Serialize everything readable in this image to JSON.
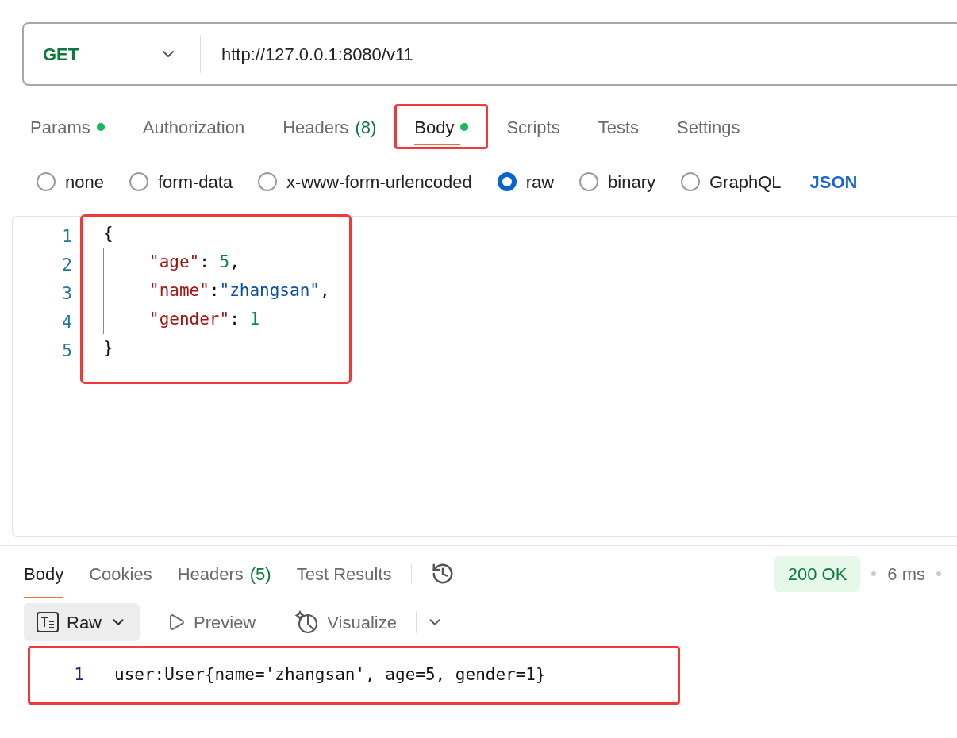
{
  "request": {
    "method": "GET",
    "url": "http://127.0.0.1:8080/v11"
  },
  "request_tabs": [
    {
      "label": "Params",
      "dot": true,
      "selected": false,
      "highlighted": false
    },
    {
      "label": "Authorization",
      "dot": false,
      "selected": false,
      "highlighted": false
    },
    {
      "label": "Headers",
      "count": "(8)",
      "dot": false,
      "selected": false,
      "highlighted": false
    },
    {
      "label": "Body",
      "dot": true,
      "selected": true,
      "highlighted": true
    },
    {
      "label": "Scripts",
      "dot": false,
      "selected": false,
      "highlighted": false
    },
    {
      "label": "Tests",
      "dot": false,
      "selected": false,
      "highlighted": false
    },
    {
      "label": "Settings",
      "dot": false,
      "selected": false,
      "highlighted": false
    }
  ],
  "body_types": [
    {
      "label": "none",
      "selected": false
    },
    {
      "label": "form-data",
      "selected": false
    },
    {
      "label": "x-www-form-urlencoded",
      "selected": false
    },
    {
      "label": "raw",
      "selected": true
    },
    {
      "label": "binary",
      "selected": false
    },
    {
      "label": "GraphQL",
      "selected": false
    }
  ],
  "body_format": "JSON",
  "editor": {
    "highlighted": true,
    "lines": [
      {
        "number": "1",
        "indent": false,
        "tokens": [
          {
            "text": "{",
            "kind": "punct"
          }
        ]
      },
      {
        "number": "2",
        "indent": true,
        "tokens": [
          {
            "text": "\"age\"",
            "kind": "key"
          },
          {
            "text": ": ",
            "kind": "punct"
          },
          {
            "text": "5",
            "kind": "number"
          },
          {
            "text": ",",
            "kind": "punct"
          }
        ]
      },
      {
        "number": "3",
        "indent": true,
        "tokens": [
          {
            "text": "\"name\"",
            "kind": "key"
          },
          {
            "text": ":",
            "kind": "punct"
          },
          {
            "text": "\"zhangsan\"",
            "kind": "string"
          },
          {
            "text": ",",
            "kind": "punct"
          }
        ]
      },
      {
        "number": "4",
        "indent": true,
        "tokens": [
          {
            "text": "\"gender\"",
            "kind": "key"
          },
          {
            "text": ": ",
            "kind": "punct"
          },
          {
            "text": "1",
            "kind": "number"
          }
        ]
      },
      {
        "number": "5",
        "indent": false,
        "tokens": [
          {
            "text": "}",
            "kind": "punct"
          }
        ]
      }
    ]
  },
  "response_tabs": [
    {
      "label": "Body",
      "selected": true
    },
    {
      "label": "Cookies",
      "selected": false
    },
    {
      "label": "Headers",
      "count": "(5)",
      "selected": false
    },
    {
      "label": "Test Results",
      "selected": false
    }
  ],
  "status": {
    "code": "200 OK",
    "time": "6 ms"
  },
  "view_modes": [
    {
      "label": "Raw",
      "selected": true
    },
    {
      "label": "Preview",
      "selected": false
    },
    {
      "label": "Visualize",
      "selected": false
    }
  ],
  "response": {
    "highlighted": true,
    "lines": [
      {
        "number": "1",
        "text": "user:User{name='zhangsan', age=5, gender=1}"
      }
    ]
  }
}
